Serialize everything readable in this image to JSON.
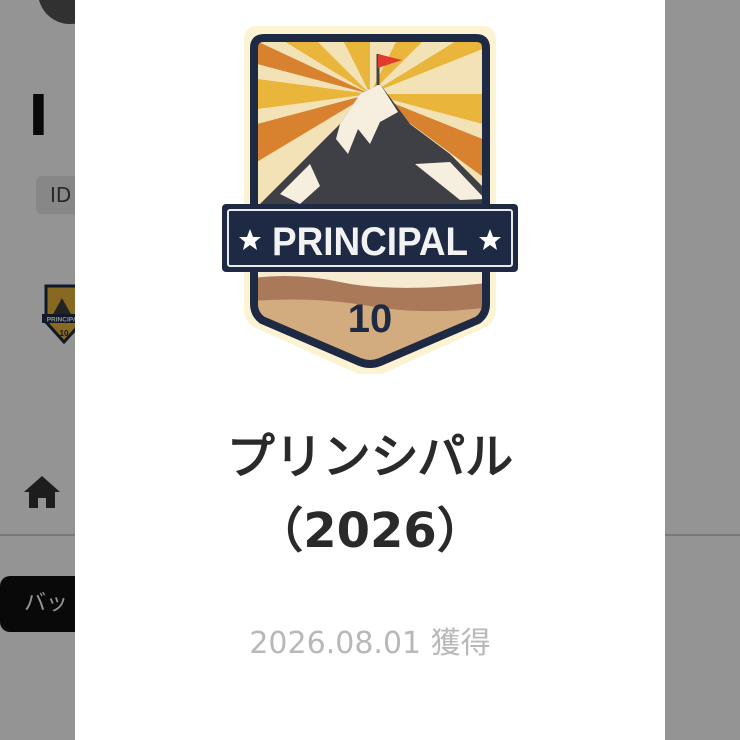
{
  "background": {
    "title": "I",
    "id_label": "ID",
    "tab_label": "バッ",
    "badge_mini": {
      "name": "PRINCIPAL",
      "number": "10"
    }
  },
  "modal": {
    "badge": {
      "name": "PRINCIPAL",
      "number": "10"
    },
    "title": "プリンシパル（2026）",
    "acquired": "2026.08.01 獲得"
  },
  "icons": [
    "home-icon",
    "star-icon",
    "flag-icon",
    "mountain-icon"
  ],
  "colors": {
    "overlay": "#8f8f8f",
    "badge_navy": "#1e2a44",
    "badge_gold": "#e9b53a",
    "badge_flag": "#e23b2e"
  }
}
